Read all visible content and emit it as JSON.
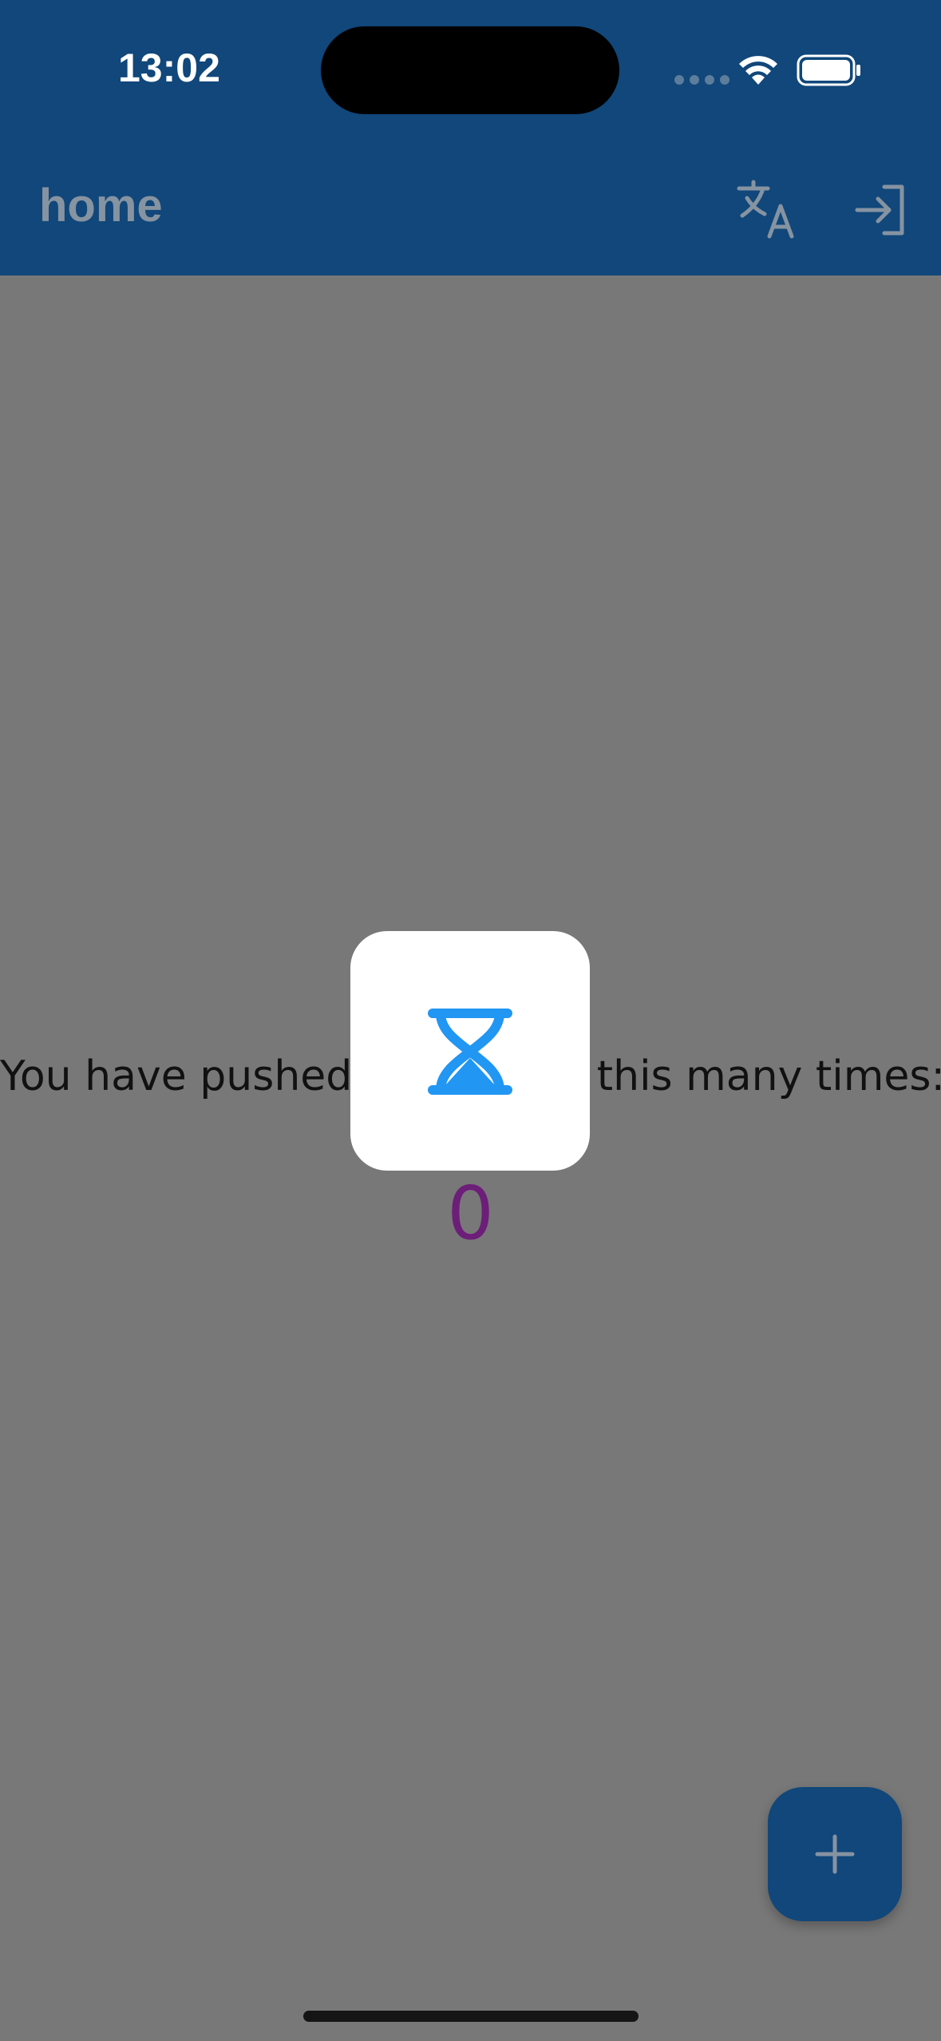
{
  "status_bar": {
    "time": "13:02"
  },
  "app_bar": {
    "title": "home",
    "actions": [
      {
        "icon": "translate-icon"
      },
      {
        "icon": "login-icon"
      }
    ]
  },
  "main": {
    "counter_label": "You have pushed the button this many times:",
    "counter_value": "0"
  },
  "loading_dialog": {
    "icon": "hourglass-icon"
  },
  "fab": {
    "icon": "plus-icon"
  },
  "colors": {
    "header": "#11477a",
    "scrim_background": "#787878",
    "counter_value": "#6c1e79",
    "loading_icon": "#2196f3"
  }
}
